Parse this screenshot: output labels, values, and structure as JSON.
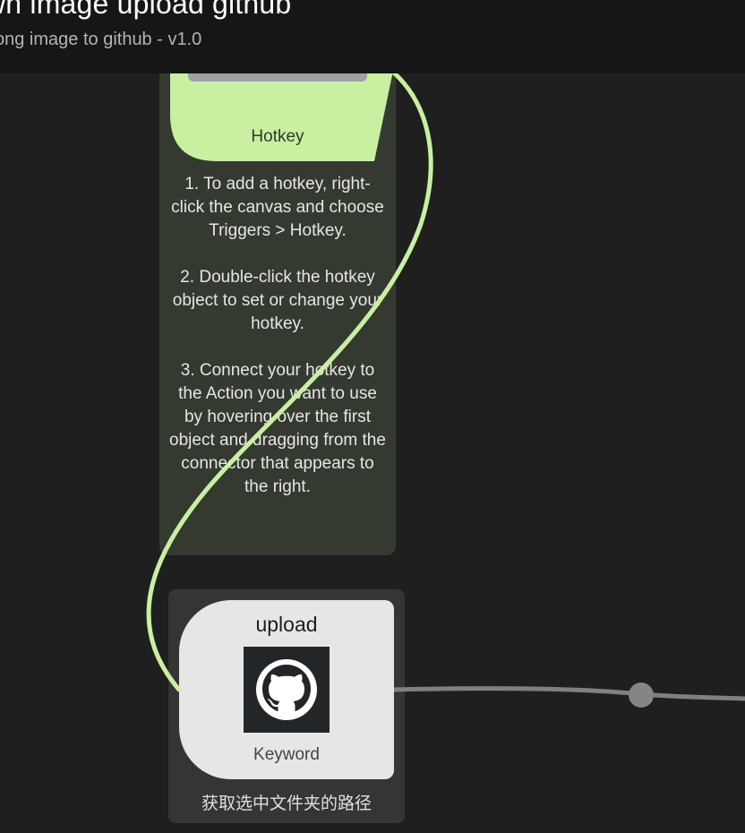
{
  "header": {
    "title": "wn image upload github",
    "subtitle": "ong image to github - v1.0"
  },
  "hotkey": {
    "label": "Hotkey"
  },
  "note": {
    "paragraphs": [
      "1. To add a hotkey, right-click the canvas and choose Triggers > Hotkey.",
      "2. Double-click the hotkey object to set or change your hotkey.",
      "3. Connect your hotkey to the Action you want to use by hovering over the first object and dragging from the connector that appears to the right."
    ]
  },
  "keyword": {
    "title": "upload",
    "type_label": "Keyword",
    "description": "获取选中文件夹的路径",
    "icon": "github-icon"
  },
  "colors": {
    "canvas": "#1f1f1f",
    "hotkey_green": "#c8f0a0",
    "wire_green": "#c8f0a0",
    "wire_grey": "#808080",
    "keyword_tile": "#e6e6e6"
  }
}
